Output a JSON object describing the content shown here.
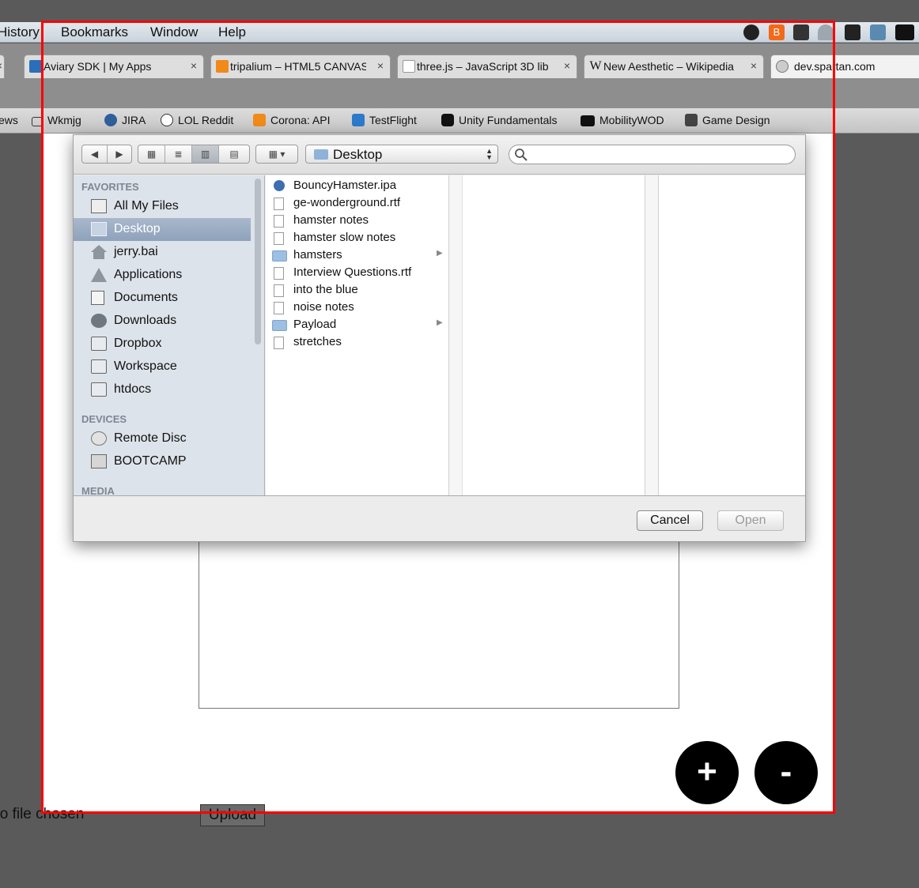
{
  "menubar": {
    "items": [
      "History",
      "Bookmarks",
      "Window",
      "Help"
    ]
  },
  "tabs": [
    {
      "title": "Aviary SDK | My Apps",
      "icon": "aviary-icon"
    },
    {
      "title": "tripalium – HTML5 CANVAS",
      "icon": "tripalium-icon"
    },
    {
      "title": "three.js – JavaScript 3D lib",
      "icon": "page-icon"
    },
    {
      "title": "New Aesthetic – Wikipedia",
      "icon": "wikipedia-icon"
    },
    {
      "title": "dev.spartan.com",
      "icon": "globe-icon"
    }
  ],
  "tab_close_glyph": "×",
  "wikipedia_glyph": "W",
  "bookmarks": [
    {
      "label": "ews"
    },
    {
      "label": "Wkmjg"
    },
    {
      "label": "JIRA"
    },
    {
      "label": "LOL Reddit"
    },
    {
      "label": "Corona: API"
    },
    {
      "label": "TestFlight"
    },
    {
      "label": "Unity Fundamentals"
    },
    {
      "label": "MobilityWOD"
    },
    {
      "label": "Game Design"
    }
  ],
  "dialog": {
    "location": "Desktop",
    "search_placeholder": "",
    "sidebar": {
      "favorites_heading": "FAVORITES",
      "favorites": [
        "All My Files",
        "Desktop",
        "jerry.bai",
        "Applications",
        "Documents",
        "Downloads",
        "Dropbox",
        "Workspace",
        "htdocs"
      ],
      "selected": "Desktop",
      "devices_heading": "DEVICES",
      "devices": [
        "Remote Disc",
        "BOOTCAMP"
      ],
      "media_heading": "MEDIA"
    },
    "files": [
      {
        "name": "BouncyHamster.ipa",
        "kind": "app"
      },
      {
        "name": "ge-wonderground.rtf",
        "kind": "doc"
      },
      {
        "name": "hamster notes",
        "kind": "doc"
      },
      {
        "name": "hamster slow notes",
        "kind": "doc"
      },
      {
        "name": "hamsters",
        "kind": "folder"
      },
      {
        "name": "Interview Questions.rtf",
        "kind": "doc"
      },
      {
        "name": "into the blue",
        "kind": "doc"
      },
      {
        "name": "noise notes",
        "kind": "doc"
      },
      {
        "name": "Payload",
        "kind": "folder"
      },
      {
        "name": "stretches",
        "kind": "doc"
      }
    ],
    "cancel_label": "Cancel",
    "open_label": "Open"
  },
  "page": {
    "zoom_in_label": "+",
    "zoom_out_label": "-",
    "file_status": "No file chosen",
    "upload_label": "Upload"
  },
  "colors": {
    "highlight_frame": "#ff0000",
    "sidebar_selected": "#9aabc2",
    "page_background": "#ffffff"
  }
}
